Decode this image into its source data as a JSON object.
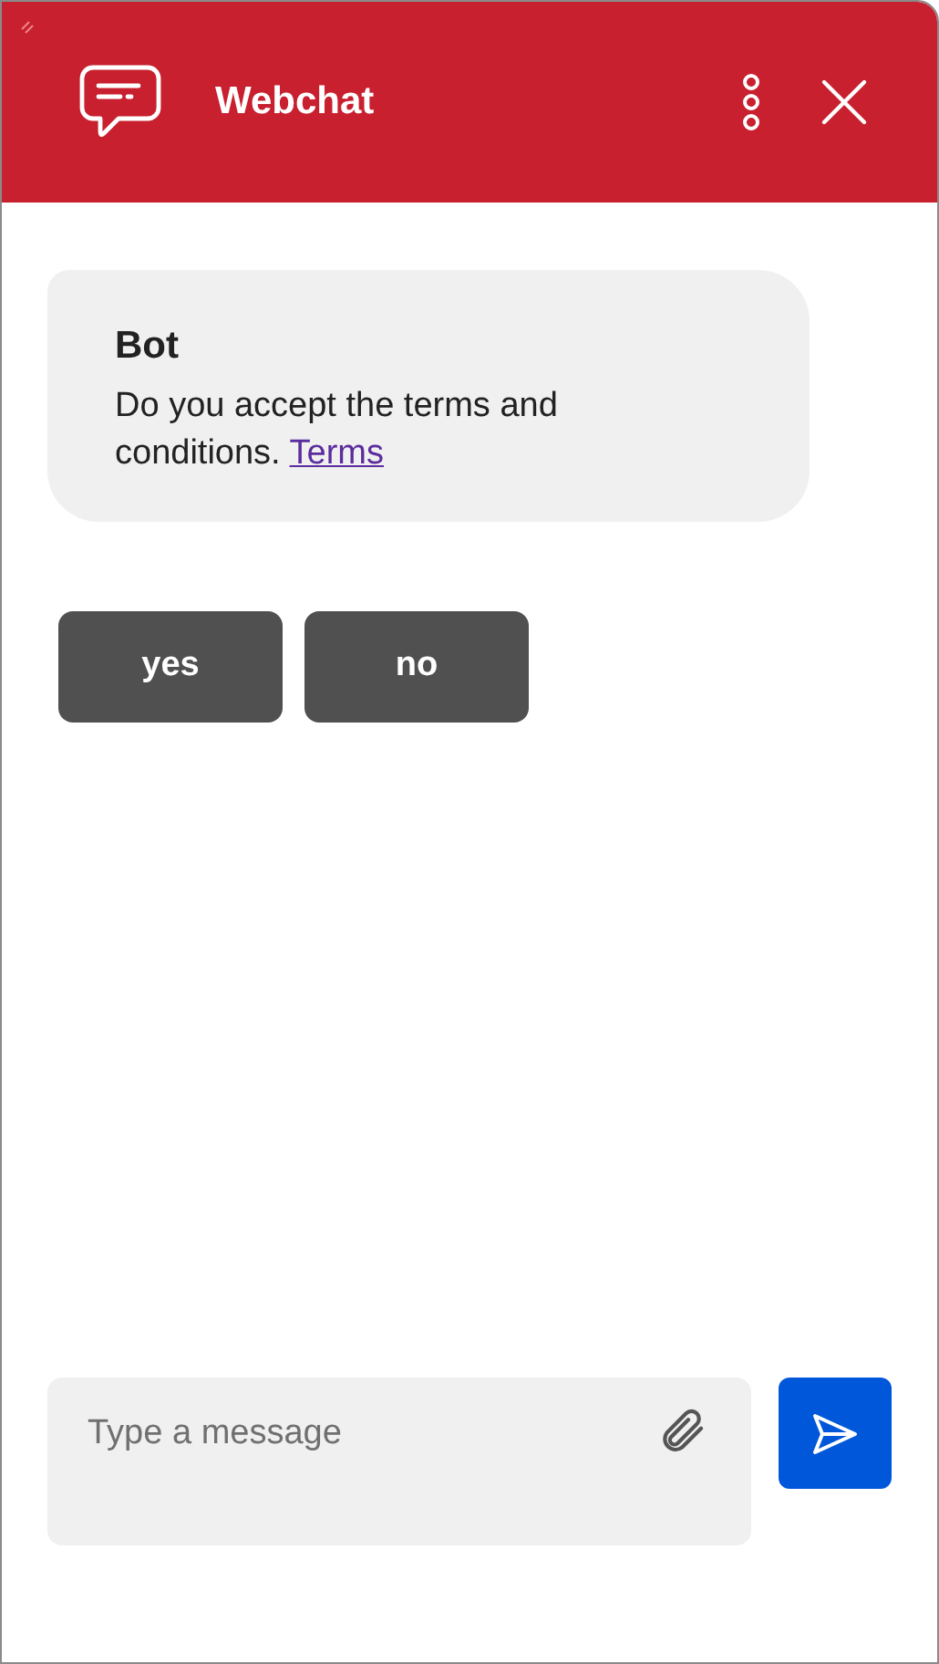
{
  "header": {
    "title": "Webchat"
  },
  "messages": [
    {
      "sender": "Bot",
      "text": "Do you accept the terms and conditions.",
      "link": "Terms"
    }
  ],
  "suggested_actions": [
    "yes",
    "no"
  ],
  "composer": {
    "placeholder": "Type a message"
  }
}
